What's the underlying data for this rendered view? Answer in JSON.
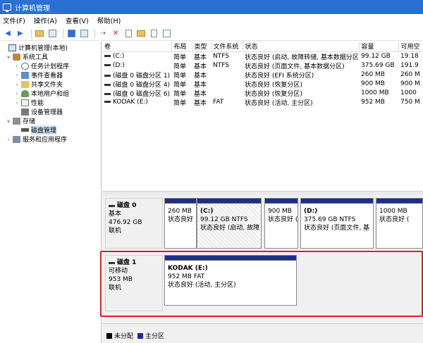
{
  "window": {
    "title": "计算机管理"
  },
  "menu": [
    "文件(F)",
    "操作(A)",
    "查看(V)",
    "帮助(H)"
  ],
  "tree": [
    {
      "label": "计算机管理(本地)",
      "level": 0,
      "icon": "computer-icon",
      "expander": ""
    },
    {
      "label": "系统工具",
      "level": 1,
      "icon": "tools-icon",
      "expander": "∨"
    },
    {
      "label": "任务计划程序",
      "level": 2,
      "icon": "clock-icon",
      "expander": "›"
    },
    {
      "label": "事件查看器",
      "level": 2,
      "icon": "event-viewer-icon",
      "expander": "›"
    },
    {
      "label": "共享文件夹",
      "level": 2,
      "icon": "shared-folder-icon",
      "expander": "›"
    },
    {
      "label": "本地用户和组",
      "level": 2,
      "icon": "users-icon",
      "expander": "›"
    },
    {
      "label": "性能",
      "level": 2,
      "icon": "performance-icon",
      "expander": "›"
    },
    {
      "label": "设备管理器",
      "level": 2,
      "icon": "device-manager-icon",
      "expander": ""
    },
    {
      "label": "存储",
      "level": 1,
      "icon": "storage-icon",
      "expander": "∨"
    },
    {
      "label": "磁盘管理",
      "level": 2,
      "icon": "disk-icon",
      "expander": "",
      "selected": true
    },
    {
      "label": "服务和应用程序",
      "level": 1,
      "icon": "services-icon",
      "expander": "›"
    }
  ],
  "volumes": {
    "columns": [
      "卷",
      "布局",
      "类型",
      "文件系统",
      "状态",
      "容量",
      "可用空"
    ],
    "rows": [
      [
        "(C:)",
        "简单",
        "基本",
        "NTFS",
        "状态良好 (启动, 故障转储, 基本数据分区)",
        "99.12 GB",
        "19.18"
      ],
      [
        "(D:)",
        "简单",
        "基本",
        "NTFS",
        "状态良好 (页面文件, 基本数据分区)",
        "375.69 GB",
        "191.9"
      ],
      [
        "(磁盘 0 磁盘分区 1)",
        "简单",
        "基本",
        "",
        "状态良好 (EFI 系统分区)",
        "260 MB",
        "260 M"
      ],
      [
        "(磁盘 0 磁盘分区 4)",
        "简单",
        "基本",
        "",
        "状态良好 (恢复分区)",
        "900 MB",
        "900 M"
      ],
      [
        "(磁盘 0 磁盘分区 6)",
        "简单",
        "基本",
        "",
        "状态良好 (恢复分区)",
        "1000 MB",
        "1000"
      ],
      [
        "KODAK (E:)",
        "简单",
        "基本",
        "FAT",
        "状态良好 (活动, 主分区)",
        "952 MB",
        "750 M"
      ]
    ]
  },
  "disks": [
    {
      "name": "磁盘 0",
      "type": "基本",
      "size": "476.92 GB",
      "state": "联机",
      "partitions": [
        {
          "label": "",
          "size": "260 MB",
          "status": "状态良好"
        },
        {
          "label": "(C:)",
          "size": "99.12 GB NTFS",
          "status": "状态良好 (启动, 故障"
        },
        {
          "label": "",
          "size": "900 MB",
          "status": "状态良好 (恢"
        },
        {
          "label": "(D:)",
          "size": "375.69 GB NTFS",
          "status": "状态良好 (页面文件, 基"
        },
        {
          "label": "",
          "size": "1000 MB",
          "status": "状态良好 ("
        }
      ]
    },
    {
      "name": "磁盘 1",
      "type": "可移动",
      "size": "953 MB",
      "state": "联机",
      "partitions": [
        {
          "label": "KODAK  (E:)",
          "size": "952 MB FAT",
          "status": "状态良好 (活动, 主分区)"
        }
      ]
    }
  ],
  "legend": [
    {
      "label": "未分配",
      "color": "#000000"
    },
    {
      "label": "主分区",
      "color": "#1b2f8f"
    }
  ]
}
